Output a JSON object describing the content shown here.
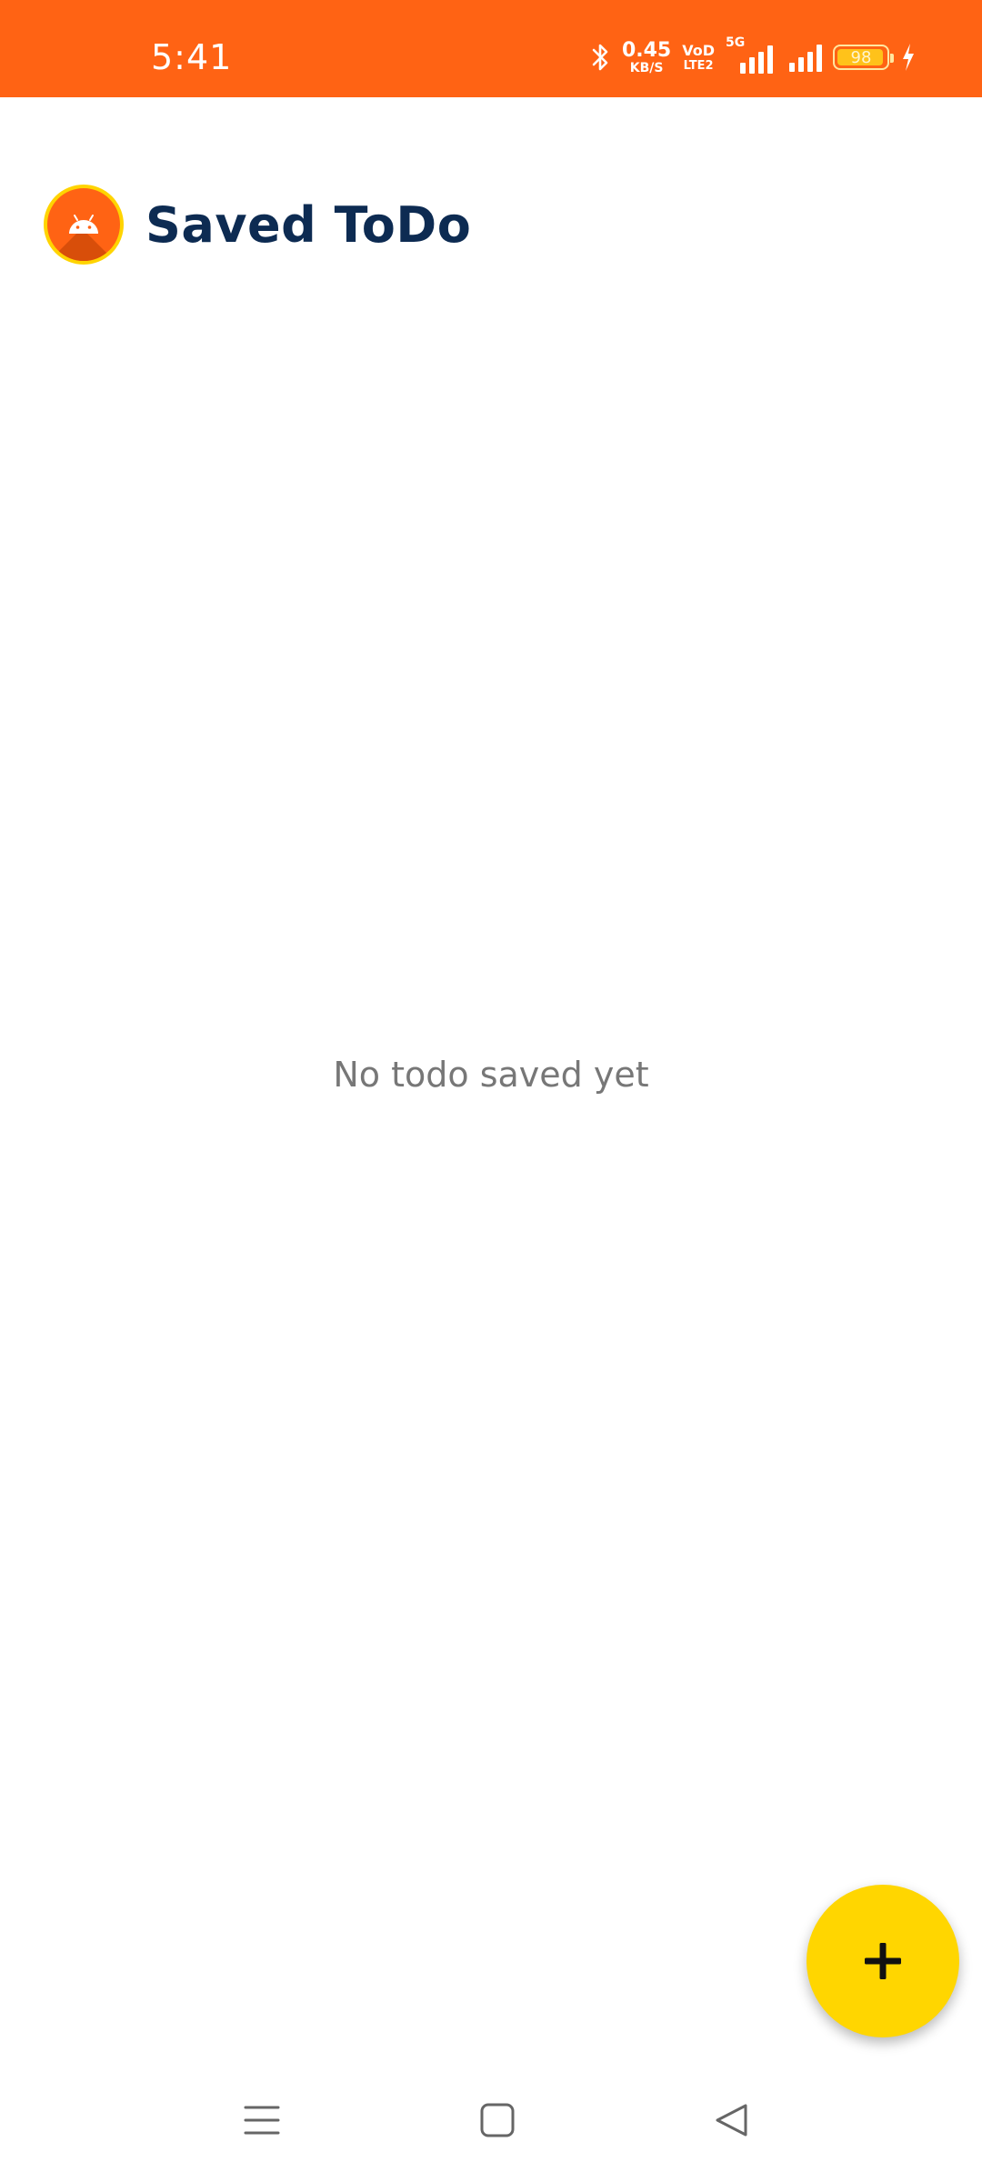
{
  "status_bar": {
    "time": "5:41",
    "net_speed_value": "0.45",
    "net_speed_unit": "KB/S",
    "volte_top": "VoD",
    "volte_bottom": "LTE2",
    "network_type": "5G",
    "battery_level": "98",
    "battery_fraction": 0.98,
    "icons": [
      "bluetooth-icon",
      "signal-icon",
      "signal-icon",
      "battery-icon",
      "charging-icon"
    ]
  },
  "header": {
    "logo_icon": "android-icon",
    "title": "Saved ToDo"
  },
  "main": {
    "empty_message": "No todo saved yet"
  },
  "fab": {
    "icon": "plus-icon"
  },
  "nav_bar": {
    "items": [
      "menu-icon",
      "home-icon",
      "back-icon"
    ]
  },
  "colors": {
    "status_bar": "#ff6314",
    "logo_background": "#ff6314",
    "logo_ring": "#ffd400",
    "title": "#0d2b52",
    "empty_text": "#777777",
    "fab": "#ffd600"
  }
}
